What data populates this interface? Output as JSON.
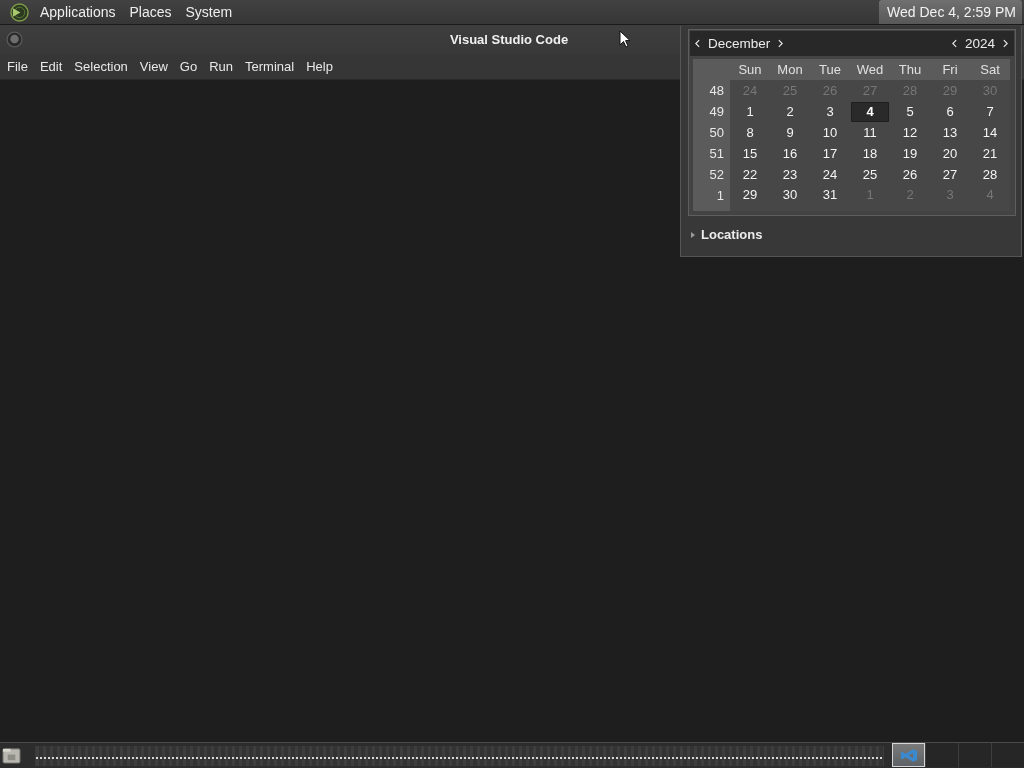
{
  "top_panel": {
    "menus": [
      {
        "label": "Applications"
      },
      {
        "label": "Places"
      },
      {
        "label": "System"
      }
    ],
    "clock": {
      "text": "Wed Dec 4, 2:59 PM",
      "active": true
    }
  },
  "window": {
    "title": "Visual Studio Code",
    "menu": [
      "File",
      "Edit",
      "Selection",
      "View",
      "Go",
      "Run",
      "Terminal",
      "Help"
    ]
  },
  "calendar": {
    "month": "December",
    "year": "2024",
    "weekdays": [
      "Sun",
      "Mon",
      "Tue",
      "Wed",
      "Thu",
      "Fri",
      "Sat"
    ],
    "weeks": [
      {
        "number": "48",
        "days": [
          {
            "day": "24",
            "other_month": true,
            "selected": false
          },
          {
            "day": "25",
            "other_month": true,
            "selected": false
          },
          {
            "day": "26",
            "other_month": true,
            "selected": false
          },
          {
            "day": "27",
            "other_month": true,
            "selected": false
          },
          {
            "day": "28",
            "other_month": true,
            "selected": false
          },
          {
            "day": "29",
            "other_month": true,
            "selected": false
          },
          {
            "day": "30",
            "other_month": true,
            "selected": false
          }
        ]
      },
      {
        "number": "49",
        "days": [
          {
            "day": "1",
            "other_month": false,
            "selected": false
          },
          {
            "day": "2",
            "other_month": false,
            "selected": false
          },
          {
            "day": "3",
            "other_month": false,
            "selected": false
          },
          {
            "day": "4",
            "other_month": false,
            "selected": true
          },
          {
            "day": "5",
            "other_month": false,
            "selected": false
          },
          {
            "day": "6",
            "other_month": false,
            "selected": false
          },
          {
            "day": "7",
            "other_month": false,
            "selected": false
          }
        ]
      },
      {
        "number": "50",
        "days": [
          {
            "day": "8",
            "other_month": false,
            "selected": false
          },
          {
            "day": "9",
            "other_month": false,
            "selected": false
          },
          {
            "day": "10",
            "other_month": false,
            "selected": false
          },
          {
            "day": "11",
            "other_month": false,
            "selected": false
          },
          {
            "day": "12",
            "other_month": false,
            "selected": false
          },
          {
            "day": "13",
            "other_month": false,
            "selected": false
          },
          {
            "day": "14",
            "other_month": false,
            "selected": false
          }
        ]
      },
      {
        "number": "51",
        "days": [
          {
            "day": "15",
            "other_month": false,
            "selected": false
          },
          {
            "day": "16",
            "other_month": false,
            "selected": false
          },
          {
            "day": "17",
            "other_month": false,
            "selected": false
          },
          {
            "day": "18",
            "other_month": false,
            "selected": false
          },
          {
            "day": "19",
            "other_month": false,
            "selected": false
          },
          {
            "day": "20",
            "other_month": false,
            "selected": false
          },
          {
            "day": "21",
            "other_month": false,
            "selected": false
          }
        ]
      },
      {
        "number": "52",
        "days": [
          {
            "day": "22",
            "other_month": false,
            "selected": false
          },
          {
            "day": "23",
            "other_month": false,
            "selected": false
          },
          {
            "day": "24",
            "other_month": false,
            "selected": false
          },
          {
            "day": "25",
            "other_month": false,
            "selected": false
          },
          {
            "day": "26",
            "other_month": false,
            "selected": false
          },
          {
            "day": "27",
            "other_month": false,
            "selected": false
          },
          {
            "day": "28",
            "other_month": false,
            "selected": false
          }
        ]
      },
      {
        "number": "1",
        "days": [
          {
            "day": "29",
            "other_month": false,
            "selected": false
          },
          {
            "day": "30",
            "other_month": false,
            "selected": false
          },
          {
            "day": "31",
            "other_month": false,
            "selected": false
          },
          {
            "day": "1",
            "other_month": true,
            "selected": false
          },
          {
            "day": "2",
            "other_month": true,
            "selected": false
          },
          {
            "day": "3",
            "other_month": true,
            "selected": false
          },
          {
            "day": "4",
            "other_month": true,
            "selected": false
          }
        ]
      }
    ],
    "locations": {
      "label": "Locations",
      "expanded": false
    }
  },
  "bottom_panel": {
    "workspaces": [
      {
        "selected": true,
        "has_window": true
      },
      {
        "selected": false,
        "has_window": false
      },
      {
        "selected": false,
        "has_window": false
      },
      {
        "selected": false,
        "has_window": false
      }
    ]
  }
}
